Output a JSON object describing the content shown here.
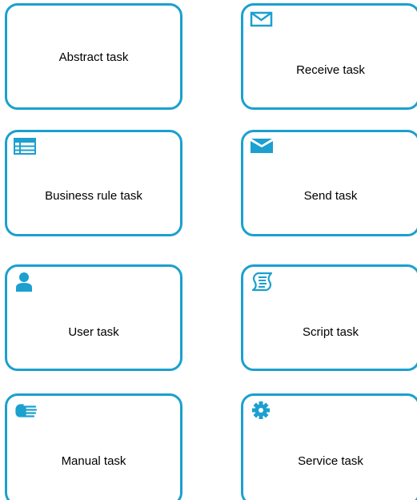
{
  "diagram": {
    "tasks": [
      {
        "id": "abstract",
        "label": "Abstract task",
        "icon": "none"
      },
      {
        "id": "receive",
        "label": "Receive task",
        "icon": "envelope-outline-icon"
      },
      {
        "id": "business_rule",
        "label": "Business rule task",
        "icon": "table-icon"
      },
      {
        "id": "send",
        "label": "Send task",
        "icon": "envelope-filled-icon"
      },
      {
        "id": "user",
        "label": "User task",
        "icon": "person-icon"
      },
      {
        "id": "script",
        "label": "Script task",
        "icon": "script-scroll-icon"
      },
      {
        "id": "manual",
        "label": "Manual task",
        "icon": "hand-icon"
      },
      {
        "id": "service",
        "label": "Service task",
        "icon": "gear-icon"
      }
    ],
    "colors": {
      "border": "#1ba0cf",
      "icon": "#1ba0cf",
      "text": "#000000",
      "background": "#ffffff"
    }
  }
}
